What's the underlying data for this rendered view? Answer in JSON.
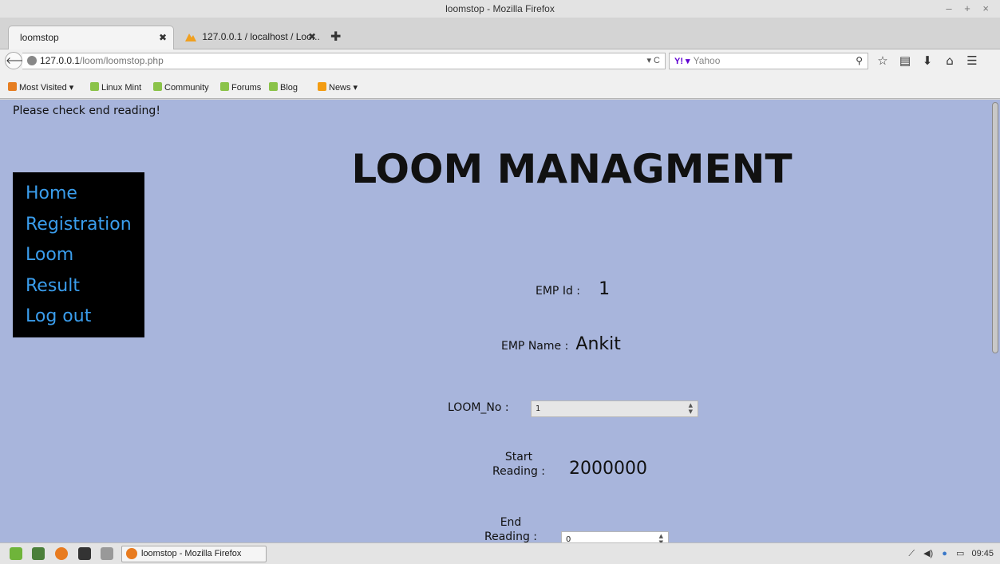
{
  "window": {
    "title": "loomstop - Mozilla Firefox",
    "controls": "– + ×"
  },
  "tabs": [
    {
      "label": "loomstop",
      "active": true
    },
    {
      "label": "127.0.0.1 / localhost / Loo...",
      "active": false
    }
  ],
  "nav": {
    "url_host": "127.0.0.1",
    "url_path": "/loom/loomstop.php",
    "search_engine": "Yahoo",
    "search_placeholder": "Yahoo"
  },
  "bookmarks": [
    "Most Visited ▾",
    "Linux Mint",
    "Community",
    "Forums",
    "Blog",
    "News ▾"
  ],
  "page": {
    "alert": "Please check end reading!",
    "title": "LOOM MANAGMENT",
    "menu": [
      "Home",
      "Registration",
      "Loom",
      "Result",
      "Log out"
    ],
    "emp_id_label": "EMP Id :",
    "emp_id_value": "1",
    "emp_name_label": "EMP Name :",
    "emp_name_value": "Ankit",
    "loom_no_label": "LOOM_No :",
    "loom_no_value": "1",
    "start_label_1": "Start",
    "start_label_2": "Reading :",
    "start_value": "2000000",
    "end_label_1": "End",
    "end_label_2": "Reading :",
    "end_value": "0"
  },
  "taskbar": {
    "task_label": "loomstop - Mozilla Firefox",
    "clock": "09:45"
  },
  "colors": {
    "page_bg": "#a8b5dc",
    "menu_bg": "#000000",
    "menu_link": "#3a9dec"
  }
}
